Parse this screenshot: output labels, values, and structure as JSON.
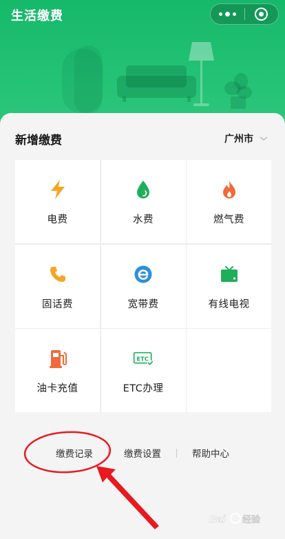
{
  "header": {
    "title": "生活缴费",
    "capsule": {
      "more_icon": "more-dots-icon",
      "close_icon": "target-close-icon"
    }
  },
  "section": {
    "title": "新增缴费",
    "city": "广州市"
  },
  "services": [
    {
      "label": "电费",
      "icon": "lightning-icon",
      "color": "#f5a623"
    },
    {
      "label": "水费",
      "icon": "water-drop-icon",
      "color": "#1fae5c"
    },
    {
      "label": "燃气费",
      "icon": "flame-icon",
      "color": "#f06a3c"
    },
    {
      "label": "固话费",
      "icon": "phone-icon",
      "color": "#f5a623"
    },
    {
      "label": "宽带费",
      "icon": "broadband-e-icon",
      "color": "#2f8fd6"
    },
    {
      "label": "有线电视",
      "icon": "tv-icon",
      "color": "#1fae5c"
    },
    {
      "label": "油卡充值",
      "icon": "fuel-pump-icon",
      "color": "#f06a3c"
    },
    {
      "label": "ETC办理",
      "icon": "etc-icon",
      "color": "#1fae5c"
    }
  ],
  "links": [
    "缴费记录",
    "缴费设置",
    "帮助中心"
  ],
  "colors": {
    "brand_green": "#1fb96c",
    "annotation_red": "#e8191f"
  },
  "watermark": "Baidu经验"
}
